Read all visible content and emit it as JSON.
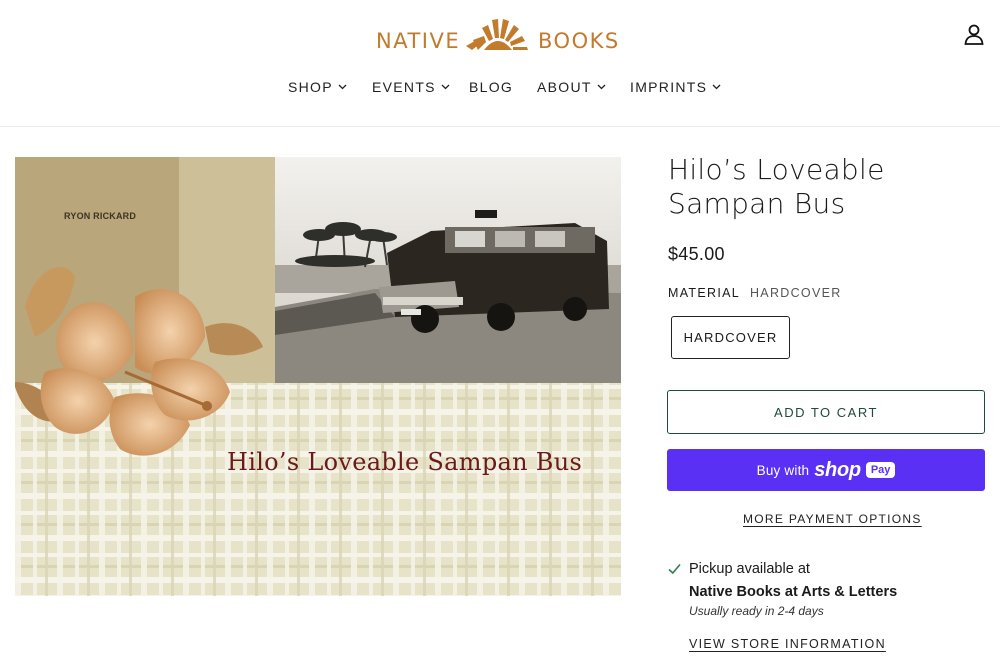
{
  "brand": {
    "word_left": "NATIVE",
    "word_right": "BOOKS",
    "color": "#c27a2c",
    "icon": "sunburst-logo-icon"
  },
  "header": {
    "account_icon": "user-icon",
    "nav": [
      {
        "label": "SHOP",
        "has_dropdown": true
      },
      {
        "label": "EVENTS",
        "has_dropdown": true
      },
      {
        "label": "BLOG",
        "has_dropdown": false
      },
      {
        "label": "ABOUT",
        "has_dropdown": true
      },
      {
        "label": "IMPRINTS",
        "has_dropdown": true
      }
    ]
  },
  "product": {
    "title": "Hilo’s Loveable Sampan Bus",
    "price": "$45.00",
    "option_label": "MATERIAL",
    "option_value": "HARDCOVER",
    "variants": [
      "HARDCOVER"
    ],
    "add_to_cart": "ADD TO CART",
    "shop_pay": {
      "prefix": "Buy with",
      "brand": "shop",
      "badge": "Pay",
      "color": "#5a31f4"
    },
    "more_payment": "MORE PAYMENT OPTIONS",
    "cover": {
      "author": "RYON RICKARD",
      "title": "Hilo’s Loveable Sampan Bus",
      "title_color": "#6b1a1a"
    }
  },
  "pickup": {
    "icon": "checkmark-icon",
    "line1": "Pickup available at",
    "location": "Native Books at Arts & Letters",
    "ready": "Usually ready in 2-4 days",
    "store_link": "VIEW STORE INFORMATION"
  }
}
